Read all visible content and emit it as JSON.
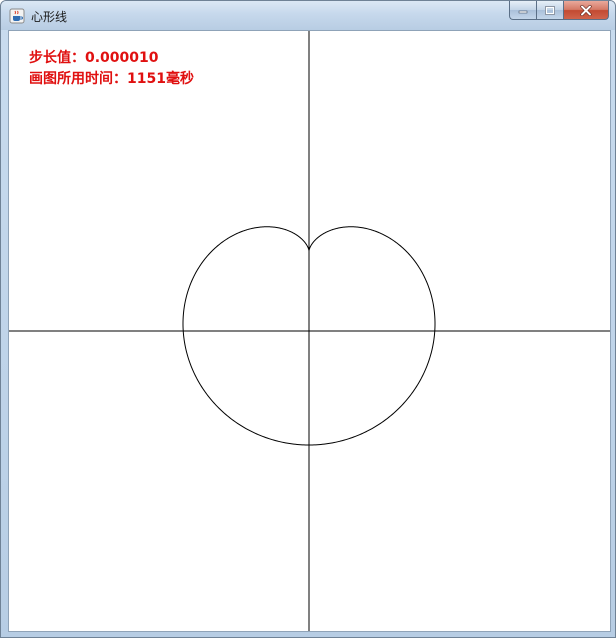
{
  "window": {
    "title": "心形线",
    "icon": "java-coffee-cup-icon"
  },
  "caption_buttons": {
    "minimize_icon": "minimize-icon",
    "maximize_icon": "maximize-icon",
    "close_icon": "close-icon"
  },
  "canvas": {
    "step_text": "步长值：0.000010",
    "time_text": "画图所用时间：1151毫秒",
    "text_color": "#e01010",
    "axis_color": "#000000",
    "curve_color": "#000000"
  },
  "chart_data": {
    "type": "line",
    "curve": "cardioid",
    "step": 1e-05,
    "draw_time_ms": 1151
  }
}
